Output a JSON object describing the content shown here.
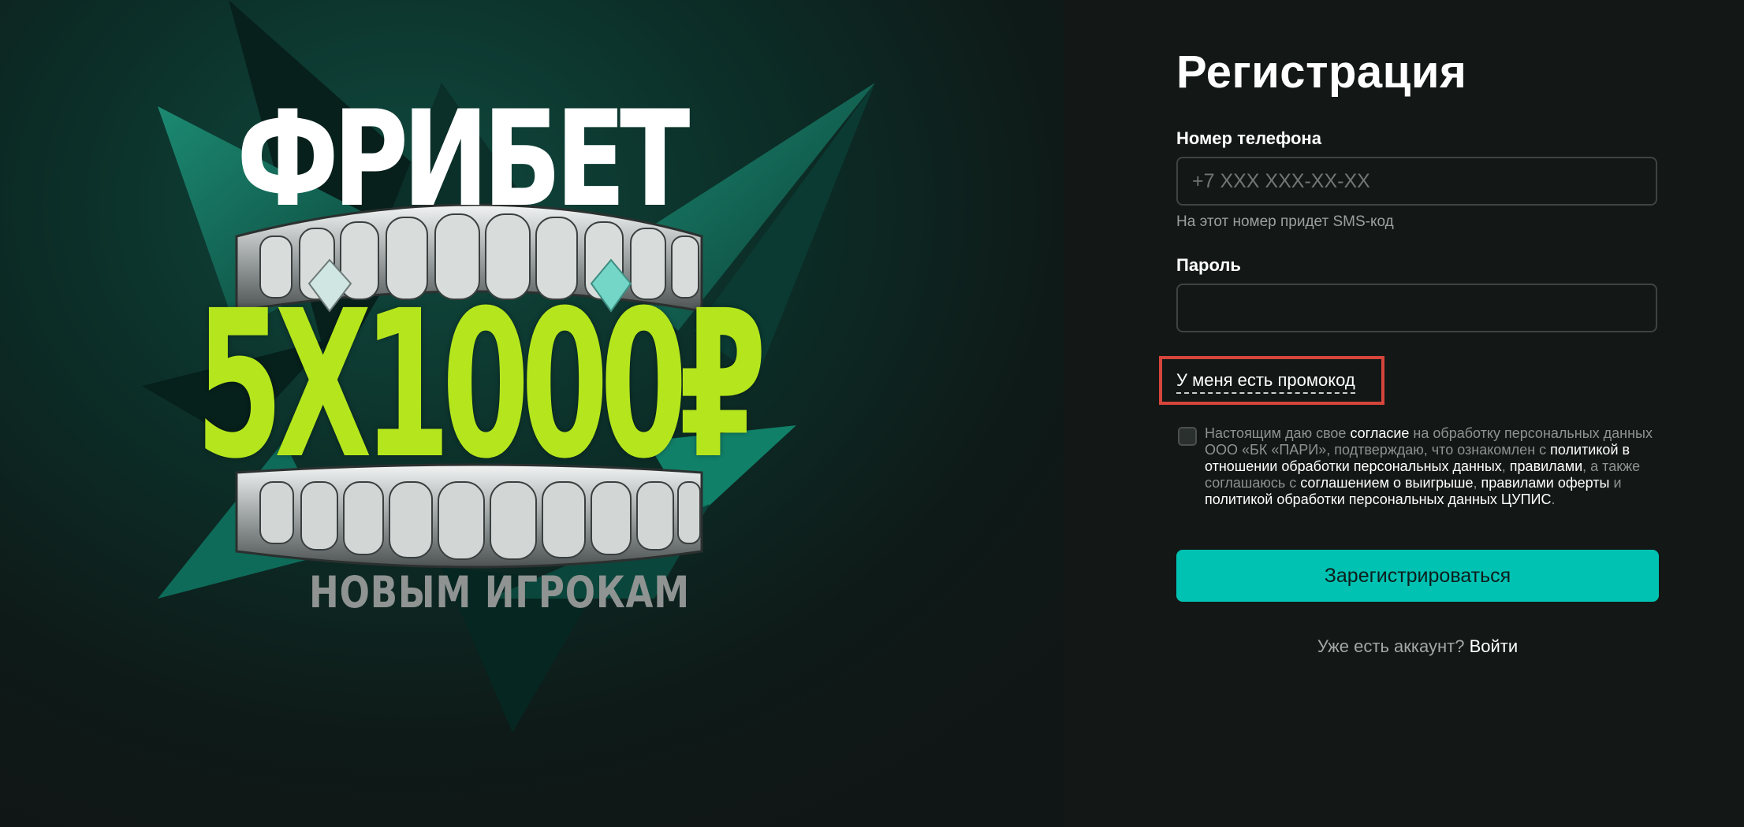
{
  "promo": {
    "title": "ФРИБЕТ",
    "amount": "5X1000₽",
    "subtitle": "НОВЫМ ИГРОКАМ"
  },
  "form": {
    "title": "Регистрация",
    "phone_label": "Номер телефона",
    "phone_placeholder": "+7 XXX XXX-XX-XX",
    "phone_value": "",
    "phone_hint": "На этот номер придет SMS-код",
    "password_label": "Пароль",
    "password_value": "",
    "promo_link": "У меня есть промокод",
    "consent": {
      "checked": false,
      "t1": "Настоящим даю свое ",
      "l1": "согласие",
      "t2": " на обработку персональных данных ООО «БК «ПАРИ», подтверждаю, что ознакомлен с ",
      "l2": "политикой в отношении обработки персональных данных",
      "t3": ", ",
      "l3": "правилами",
      "t4": ", а также соглашаюсь с ",
      "l4": "соглашением о выигрыше",
      "t5": ", ",
      "l5": "правилами оферты",
      "t6": " и ",
      "l6": "политикой обработки персональных данных ЦУПИС",
      "t7": "."
    },
    "register_button": "Зарегистрироваться",
    "login_prompt": "Уже есть аккаунт?",
    "login_link": "Войти"
  },
  "colors": {
    "accent": "#00c2b2",
    "promo_green": "#b5e61d",
    "highlight_box": "#d6453b",
    "background": "#131816"
  }
}
